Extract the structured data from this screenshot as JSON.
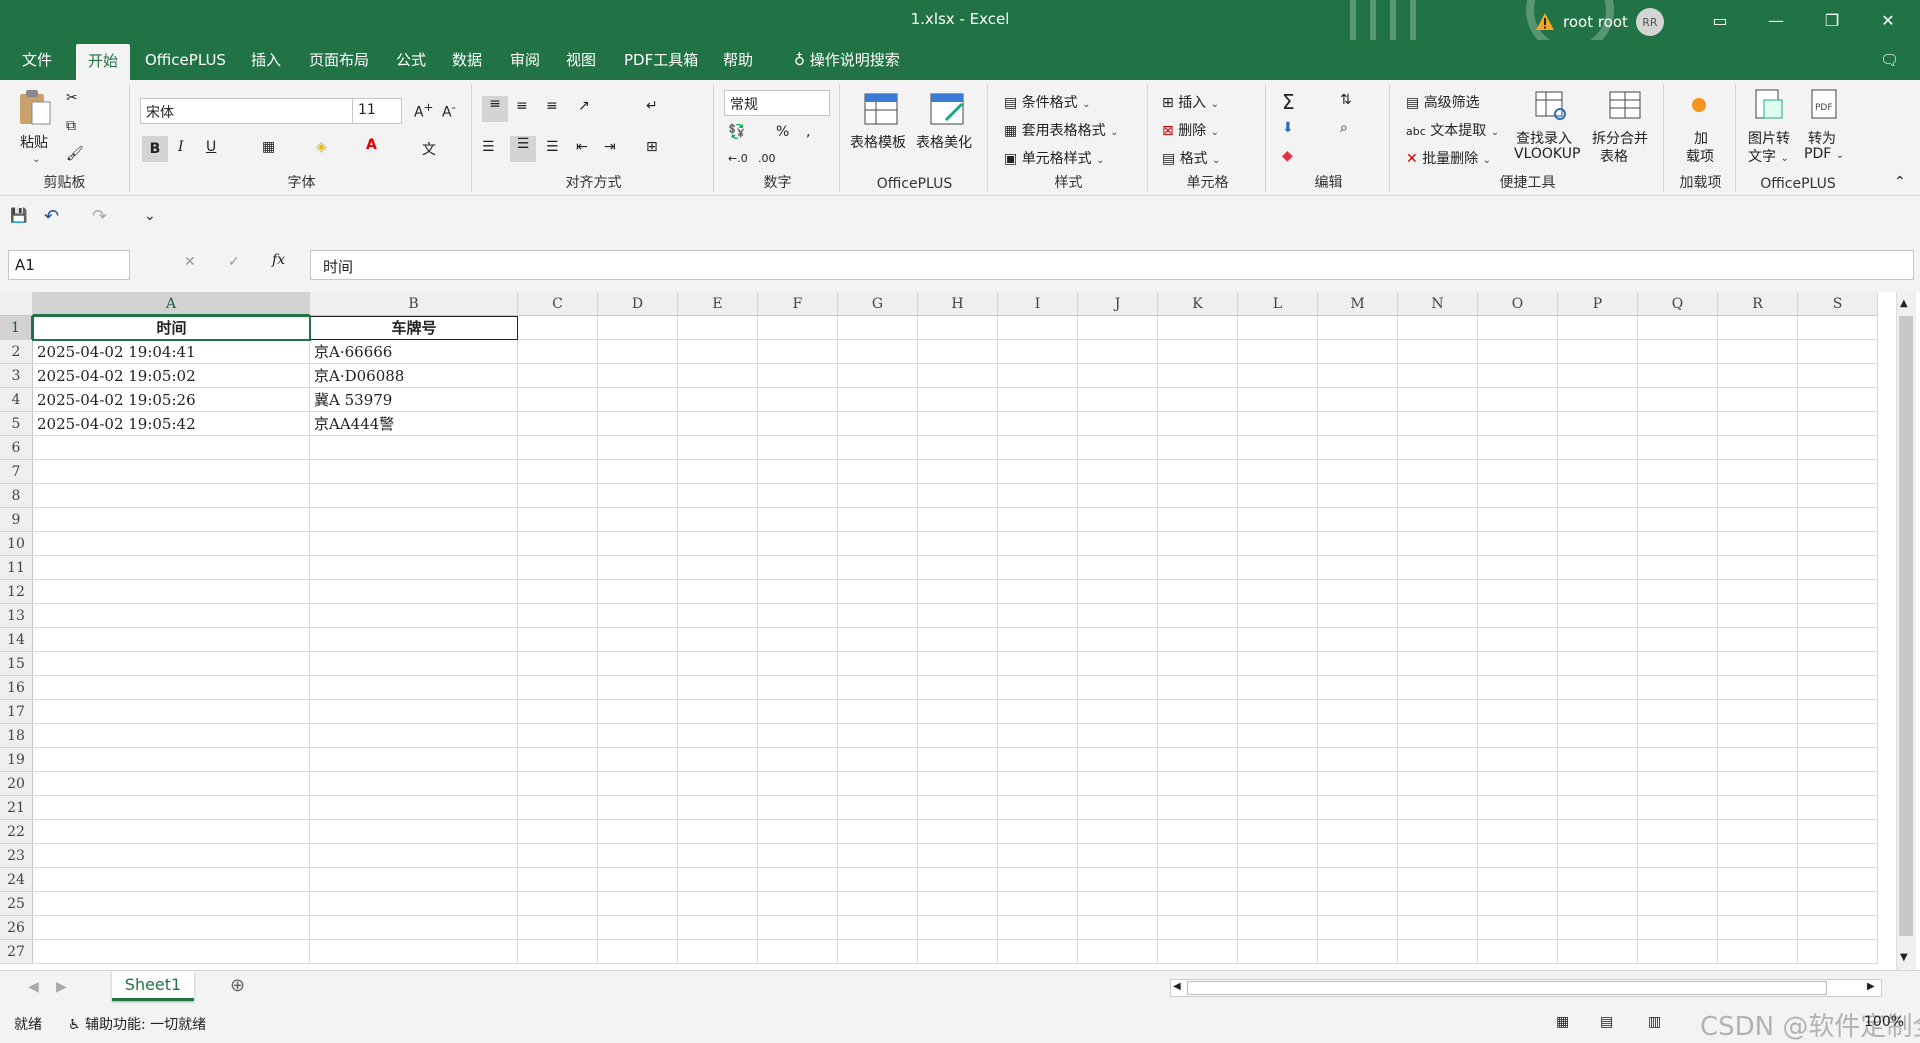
{
  "window": {
    "title": "1.xlsx  -  Excel",
    "user_name": "root root",
    "avatar_initials": "RR",
    "accent": "#217346"
  },
  "menu": [
    "文件",
    "开始",
    "OfficePLUS",
    "插入",
    "页面布局",
    "公式",
    "数据",
    "审阅",
    "视图",
    "PDF工具箱",
    "帮助",
    "操作说明搜索"
  ],
  "ribbon": {
    "clipboard": {
      "paste": "粘贴",
      "label": "剪贴板"
    },
    "font": {
      "name": "宋体",
      "size": "11",
      "label": "字体"
    },
    "align": {
      "label": "对齐方式"
    },
    "number": {
      "format": "常规",
      "label": "数字"
    },
    "officeplus": {
      "template": "表格模板",
      "beautify": "表格美化",
      "label": "OfficePLUS"
    },
    "styles": {
      "conditional": "条件格式",
      "table_format": "套用表格格式",
      "cell_style": "单元格样式",
      "label": "样式"
    },
    "cells": {
      "insert": "插入",
      "delete": "删除",
      "format": "格式",
      "label": "单元格"
    },
    "edit": {
      "label": "编辑"
    },
    "tools": {
      "advanced_filter": "高级筛选",
      "text_extract": "文本提取",
      "batch_delete": "批量删除",
      "vlookup_1": "查找录入",
      "vlookup_2": "VLOOKUP",
      "split_1": "拆分合并",
      "split_2": "表格",
      "label": "便捷工具"
    },
    "addins": {
      "add_1": "加",
      "add_2": "载项",
      "label": "加载项"
    },
    "pdf": {
      "img_1": "图片转",
      "img_2": "文字",
      "pdf_1": "转为",
      "pdf_2": "PDF",
      "label": "OfficePLUS"
    }
  },
  "formula": {
    "name_box": "A1",
    "fx": "fx",
    "content": "时间"
  },
  "columns": [
    "A",
    "B",
    "C",
    "D",
    "E",
    "F",
    "G",
    "H",
    "I",
    "J",
    "K",
    "L",
    "M",
    "N",
    "O",
    "P",
    "Q",
    "R",
    "S"
  ],
  "rows": [
    "1",
    "2",
    "3",
    "4",
    "5",
    "6",
    "7",
    "8",
    "9",
    "10",
    "11",
    "12",
    "13",
    "14",
    "15",
    "16",
    "17",
    "18",
    "19",
    "20",
    "21",
    "22",
    "23",
    "24",
    "25",
    "26",
    "27"
  ],
  "cells": {
    "header": [
      "时间",
      "车牌号"
    ],
    "data": [
      [
        "2025-04-02 19:04:41",
        "京A·66666"
      ],
      [
        "2025-04-02 19:05:02",
        "京A·D06088"
      ],
      [
        "2025-04-02 19:05:26",
        "冀A 53979"
      ],
      [
        "2025-04-02 19:05:42",
        "京AA444警"
      ]
    ]
  },
  "sheets": [
    "Sheet1"
  ],
  "status": {
    "ready": "就绪",
    "accessibility": "辅助功能: 一切就绪",
    "zoom": "100%",
    "watermark": "CSDN @软件定制全职"
  }
}
